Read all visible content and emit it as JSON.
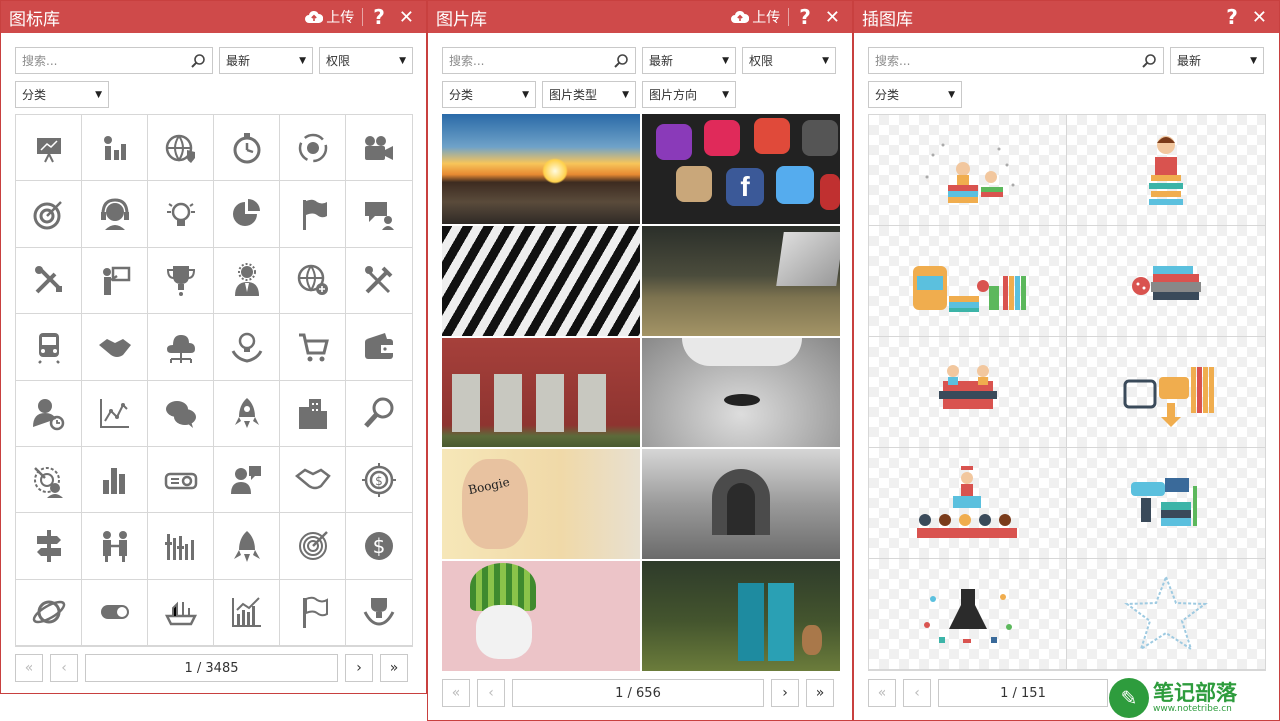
{
  "icon_library": {
    "title": "图标库",
    "upload_label": "上传",
    "help_label": "?",
    "close_label": "✕",
    "search_placeholder": "搜索...",
    "sort": "最新",
    "permission": "权限",
    "category": "分类",
    "page_text": "1 / 3485",
    "icons": [
      "presentation-board-icon",
      "people-chart-icon",
      "globe-shield-icon",
      "stopwatch-icon",
      "gear-cycle-icon",
      "movie-camera-icon",
      "target-arrow-icon",
      "support-headset-icon",
      "lightbulb-icon",
      "pie-chart-icon",
      "flag-icon",
      "chat-user-icon",
      "tools-icon",
      "presenter-icon",
      "trophy-icon",
      "manager-gear-icon",
      "globe-add-icon",
      "wrench-screwdriver-icon",
      "train-icon",
      "handshake-icon",
      "cloud-network-icon",
      "idea-hand-icon",
      "shopping-cart-icon",
      "wallet-icon",
      "user-clock-icon",
      "line-chart-icon",
      "chat-bubbles-icon",
      "rocket-icon",
      "buildings-icon",
      "magnifier-icon",
      "target-user-icon",
      "bar-chart-icon",
      "projector-icon",
      "user-speech-icon",
      "handshake-outline-icon",
      "target-dollar-icon",
      "signpost-icon",
      "two-people-icon",
      "equalizer-chart-icon",
      "rocket-outline-icon",
      "dartboard-icon",
      "dollar-circle-icon",
      "planet-icon",
      "toggle-icon",
      "boat-icon",
      "growth-chart-icon",
      "flag-outline-icon",
      "trophy-hands-icon"
    ]
  },
  "image_library": {
    "title": "图片库",
    "upload_label": "上传",
    "help_label": "?",
    "close_label": "✕",
    "search_placeholder": "搜索...",
    "sort": "最新",
    "permission": "权限",
    "category": "分类",
    "image_type": "图片类型",
    "orientation": "图片方向",
    "page_text": "1 / 656",
    "photos": [
      "sunset-road-photo",
      "social-apps-photo",
      "zebra-photo",
      "laptop-desk-photo",
      "red-wall-doors-photo",
      "mustache-man-photo",
      "boogie-face-photo",
      "arched-corridor-photo",
      "watermelon-face-photo",
      "portable-toilets-photo"
    ],
    "boogie_text": "Boogie"
  },
  "illustration_library": {
    "title": "插图库",
    "help_label": "?",
    "close_label": "✕",
    "search_placeholder": "搜索...",
    "sort": "最新",
    "category": "分类",
    "page_text": "1 / 151",
    "illustrations": [
      "reading-kids-illustration",
      "reading-boy-illustration",
      "school-supplies-illustration",
      "books-stack-illustration",
      "study-group-illustration",
      "library-shelf-illustration",
      "graduation-lecture-illustration",
      "science-lab-illustration",
      "chemistry-icons-illustration",
      "star-doodle-illustration"
    ]
  },
  "watermark": {
    "text": "笔记部落",
    "sub": "www.notetribe.cn"
  },
  "colors": {
    "accent": "#cf4a4a",
    "icon_gray": "#707070",
    "border": "#d7d7d7"
  }
}
